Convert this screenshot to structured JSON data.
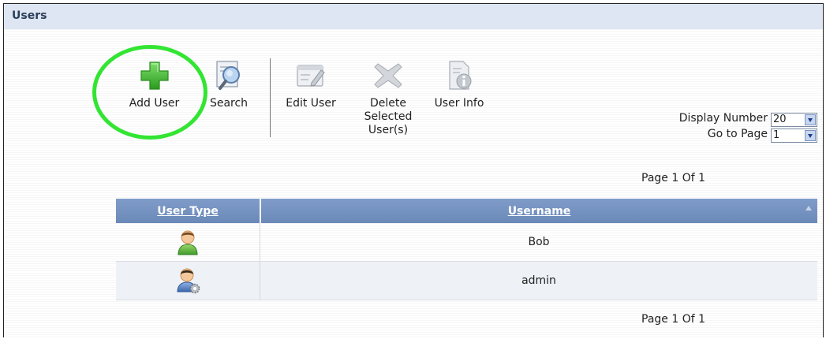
{
  "panel": {
    "title": "Users"
  },
  "toolbar": {
    "add_user": "Add User",
    "search": "Search",
    "edit_user": "Edit User",
    "delete_selected": "Delete\nSelected\nUser(s)",
    "user_info": "User Info"
  },
  "options": {
    "display_number_label": "Display Number",
    "display_number_value": "20",
    "go_to_page_label": "Go to Page",
    "go_to_page_value": "1"
  },
  "pagination": {
    "top": "Page 1 Of 1",
    "bottom": "Page 1 Of 1"
  },
  "table": {
    "columns": [
      "User Type",
      "Username"
    ],
    "rows": [
      {
        "user_type_icon": "user-icon",
        "username": "Bob"
      },
      {
        "user_type_icon": "admin-user-icon",
        "username": "admin"
      }
    ]
  },
  "colors": {
    "header_bg": "#dde6f2",
    "table_header_bg": "#7f9cc9",
    "highlight_circle": "#33e533",
    "add_icon_green": "#33b82a"
  }
}
